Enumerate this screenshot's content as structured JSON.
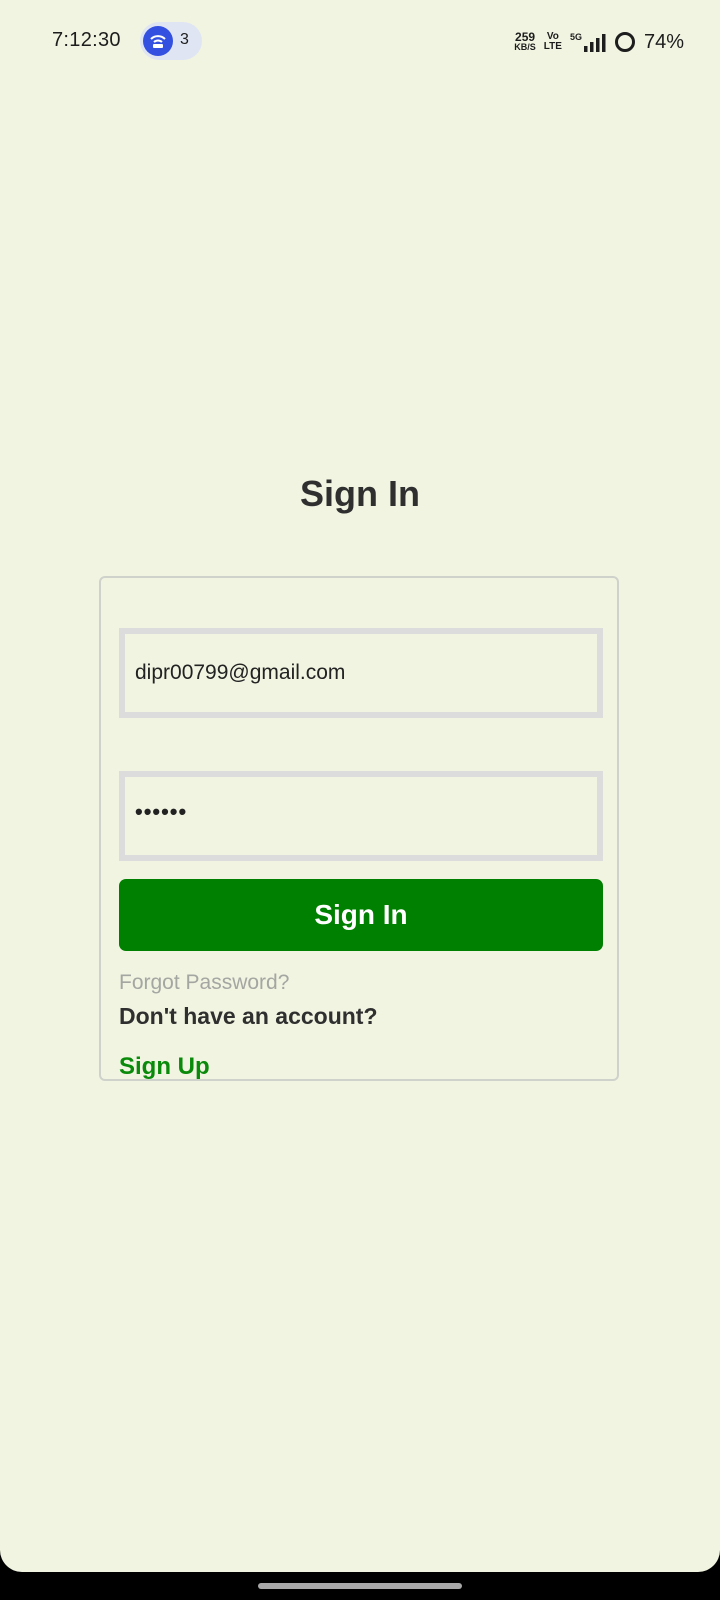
{
  "status_bar": {
    "time": "7:12:30",
    "hotspot_count": "3",
    "net_speed_value": "259",
    "net_speed_unit": "KB/S",
    "volte_top": "Vo",
    "volte_bottom": "LTE",
    "network_type": "5G",
    "battery_percent": "74%",
    "icons": [
      "hotspot-icon",
      "signal-icon",
      "battery-icon"
    ]
  },
  "page": {
    "title": "Sign In"
  },
  "form": {
    "email_value": "dipr00799@gmail.com",
    "password_value": "••••••",
    "signin_label": "Sign In",
    "forgot_label": "Forgot Password?",
    "no_account_label": "Don't have an account?",
    "signup_label": "Sign Up"
  },
  "colors": {
    "background": "#f1f4e1",
    "primary_button": "#008000",
    "signup_link": "#0a8a0a",
    "hotspot_accent": "#3450e0"
  }
}
